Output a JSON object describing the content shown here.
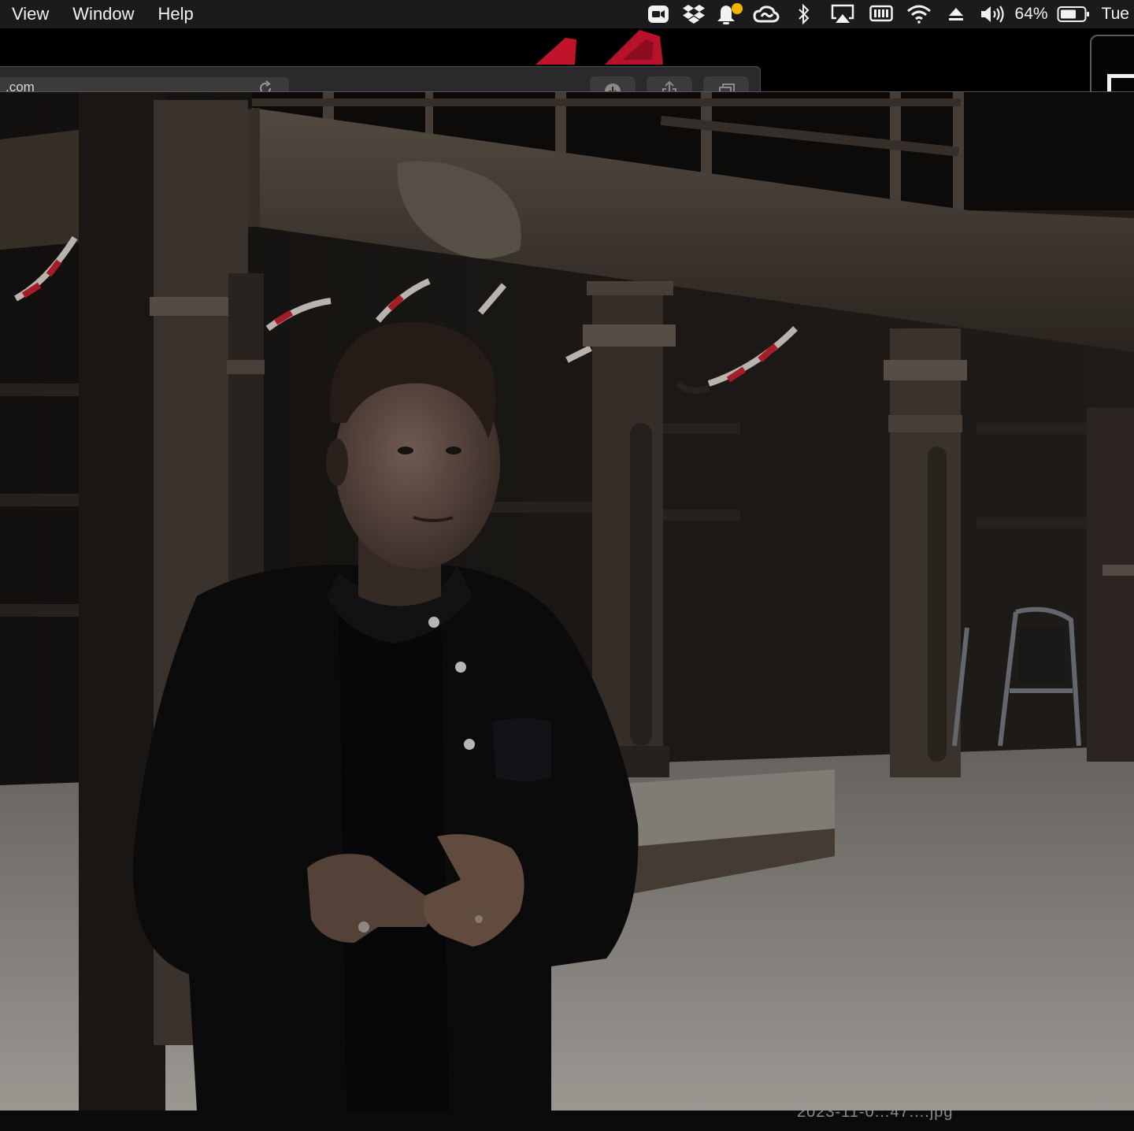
{
  "menubar": {
    "menus": [
      "View",
      "Window",
      "Help"
    ],
    "battery_percent": "64%",
    "clock": "Tue",
    "notification_badge_color": "#f5b400",
    "tray_icons": [
      "video-camera-icon",
      "dropbox-icon",
      "notification-icon",
      "creative-cloud-icon",
      "bluetooth-icon",
      "airplay-icon",
      "memory-icon",
      "wifi-icon",
      "eject-icon",
      "volume-icon",
      "battery-icon"
    ]
  },
  "browser": {
    "url_fragment": ".com"
  },
  "video": {
    "description_icon": "video-still"
  },
  "bottom": {
    "filename_fragment": "2023-11-0...47....jpg"
  }
}
